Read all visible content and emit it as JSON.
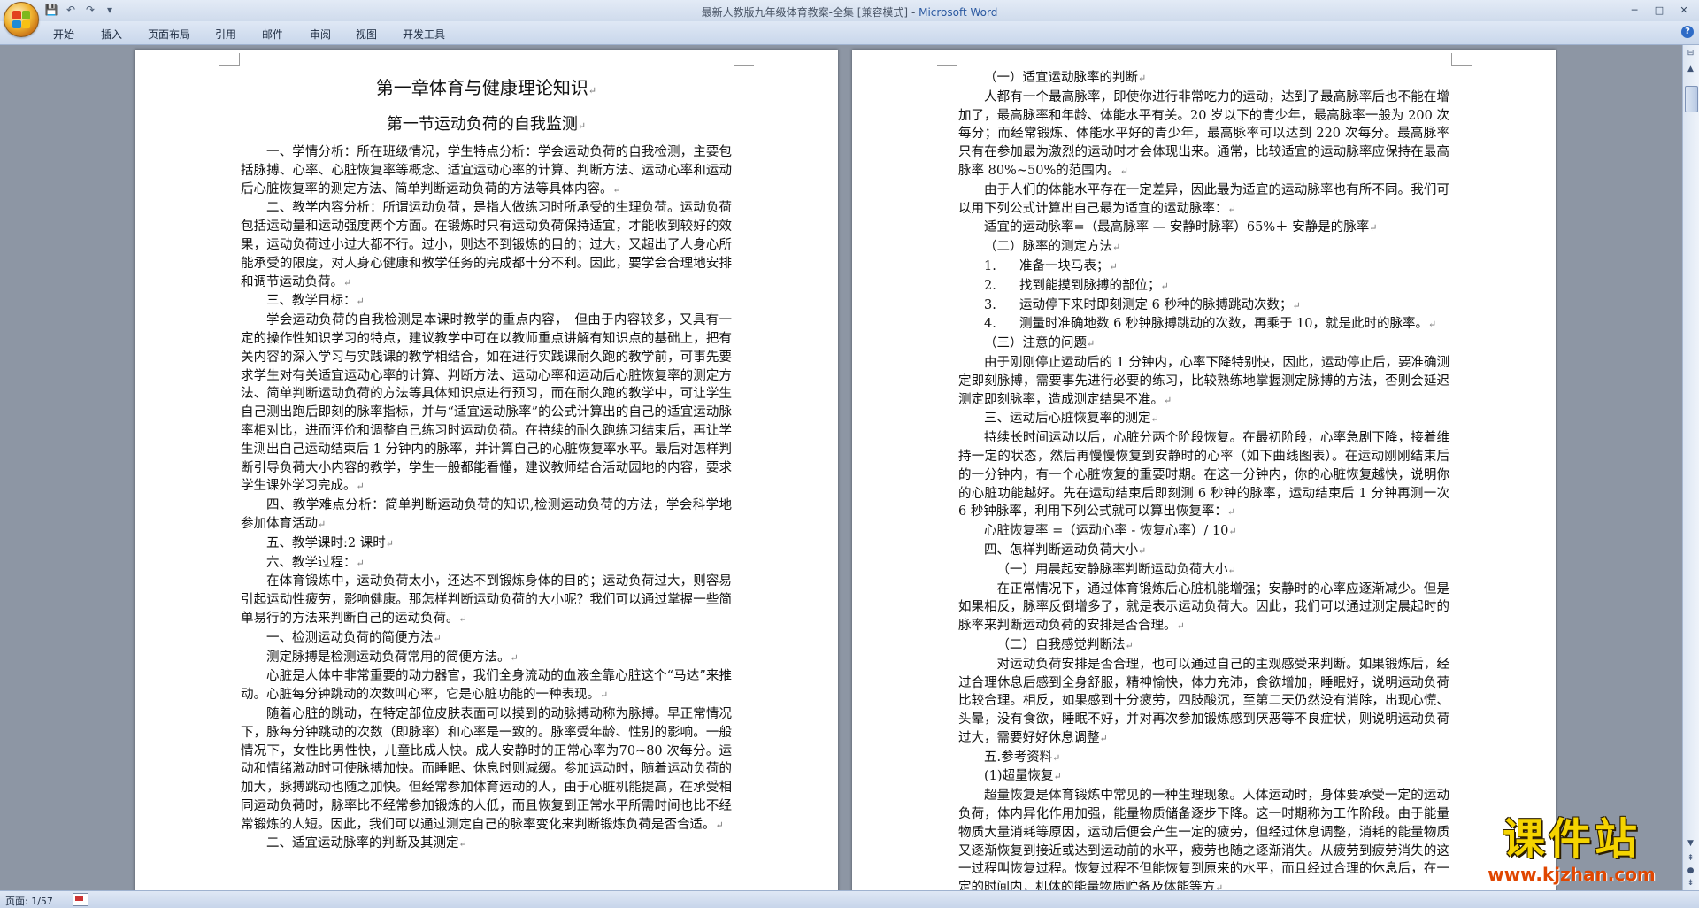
{
  "window": {
    "title": "最新人教版九年级体育教案-全集 [兼容模式]",
    "title_sep": " - ",
    "app_name": "Microsoft Word"
  },
  "quick_access": {
    "save": "💾",
    "undo": "↶",
    "redo": "↷",
    "customize": "▾"
  },
  "ribbon": {
    "tabs": [
      "开始",
      "插入",
      "页面布局",
      "引用",
      "邮件",
      "审阅",
      "视图",
      "开发工具"
    ]
  },
  "help_label": "?",
  "status": {
    "page": "页面: 1/57"
  },
  "watermark": {
    "title": "课件站",
    "url": "www.kjzhan.com"
  },
  "page1": {
    "heading1": "第一章体育与健康理论知识",
    "heading2": "第一节运动负荷的自我监测",
    "paragraphs": [
      "一、学情分析：所在班级情况，学生特点分析：学会运动负荷的自我检测，主要包括脉搏、心率、心脏恢复率等概念、适宜运动心率的计算、判断方法、运动心率和运动后心脏恢复率的测定方法、简单判断运动负荷的方法等具体内容。",
      "二、教学内容分析：所谓运动负荷，是指人做练习时所承受的生理负荷。运动负荷包括运动量和运动强度两个方面。在锻炼时只有运动负荷保持适宜，才能收到较好的效果，运动负荷过小过大都不行。过小，则达不到锻炼的目的；过大，又超出了人身心所能承受的限度，对人身心健康和教学任务的完成都十分不利。因此，要学会合理地安排和调节运动负荷。",
      "三、教学目标：",
      "学会运动负荷的自我检测是本课时教学的重点内容，　但由于内容较多，又具有一定的操作性知识学习的特点，建议教学中可在以教师重点讲解有知识点的基础上，把有关内容的深入学习与实践课的教学相结合，如在进行实践课耐久跑的教学前，可事先要求学生对有关适宜运动心率的计算、判断方法、运动心率和运动后心脏恢复率的测定方法、简单判断运动负荷的方法等具体知识点进行预习，而在耐久跑的教学中，可让学生自己测出跑后即刻的脉率指标，并与“适宜运动脉率”的公式计算出的自己的适宜运动脉率相对比，进而评价和调整自己练习时运动负荷。在持续的耐久跑练习结束后，再让学生测出自己运动结束后 1 分钟内的脉率，并计算自己的心脏恢复率水平。最后对怎样判断引导负荷大小内容的教学，学生一般都能看懂，建议教师结合活动园地的内容，要求学生课外学习完成。",
      "四、教学难点分析：简单判断运动负荷的知识,检测运动负荷的方法，学会科学地参加体育活动",
      "五、教学课时:2 课时",
      "六、教学过程：",
      "在体育锻炼中，运动负荷太小，还达不到锻炼身体的目的；运动负荷过大，则容易引起运动性疲劳，影响健康。那怎样判断运动负荷的大小呢？我们可以通过掌握一些简单易行的方法来判断自己的运动负荷。",
      "一、检测运动负荷的简便方法",
      "测定脉搏是检测运动负荷常用的简便方法。",
      "心脏是人体中非常重要的动力器官，我们全身流动的血液全靠心脏这个“马达”来推动。心脏每分钟跳动的次数叫心率，它是心脏功能的一种表现。",
      "随着心脏的跳动，在特定部位皮肤表面可以摸到的动脉搏动称为脉搏。早正常情况下，脉每分钟跳动的次数（即脉率）和心率是一致的。脉率受年龄、性别的影响。一般情况下，女性比男性快，儿童比成人快。成人安静时的正常心率为70~80 次每分。运动和情绪激动时可使脉搏加快。而睡眠、休息时则减缓。参加运动时，随着运动负荷的加大，脉搏跳动也随之加快。但经常参加体育运动的人，由于心脏机能提高，在承受相同运动负荷时，脉率比不经常参加锻炼的人低，而且恢复到正常水平所需时间也比不经常锻炼的人短。因此，我们可以通过测定自己的脉率变化来判断锻炼负荷是否合适。",
      "二、适宜运动脉率的判断及其测定"
    ]
  },
  "page2": {
    "paragraphs_a": [
      "（一）适宜运动脉率的判断",
      "人都有一个最高脉率，即使你进行非常吃力的运动，达到了最高脉率后也不能在增加了，最高脉率和年龄、体能水平有关。20 岁以下的青少年，最高脉率一般为 200 次每分；而经常锻炼、体能水平好的青少年，最高脉率可以达到 220 次每分。最高脉率只有在参加最为激烈的运动时才会体现出来。通常，比较适宜的运动脉率应保持在最高脉率 80%~50%的范围内。",
      "由于人们的体能水平存在一定差异，因此最为适宜的运动脉率也有所不同。我们可以用下列公式计算出自己最为适宜的运动脉率：",
      "适宜的运动脉率=（最高脉率 — 安静时脉率）65%＋ 安静是的脉率",
      "（二）脉率的测定方法"
    ],
    "steps": [
      {
        "n": "1.",
        "t": "准备一块马表；"
      },
      {
        "n": "2.",
        "t": "找到能摸到脉搏的部位；"
      },
      {
        "n": "3.",
        "t": "运动停下来时即刻测定 6 秒种的脉搏跳动次数；"
      },
      {
        "n": "4.",
        "t": "测量时准确地数 6 秒钟脉搏跳动的次数，再乘于 10，就是此时的脉率。"
      }
    ],
    "paragraphs_b": [
      "（三）注意的问题",
      "由于刚刚停止运动后的 1 分钟内，心率下降特别快，因此，运动停止后，要准确测定即刻脉搏，需要事先进行必要的练习，比较熟练地掌握测定脉搏的方法，否则会延迟测定即刻脉率，造成测定结果不准。",
      "三、运动后心脏恢复率的测定",
      "持续长时间运动以后，心脏分两个阶段恢复。在最初阶段，心率急剧下降，接着维持一定的状态，然后再慢慢恢复到安静时的心率（如下曲线图表）。在运动刚刚结束后的一分钟内，有一个心脏恢复的重要时期。在这一分钟内，你的心脏恢复越快，说明你的心脏功能越好。先在运动结束后即刻测 6 秒钟的脉率，运动结束后 1 分钟再测一次 6 秒钟脉率，利用下列公式就可以算出恢复率：",
      "心脏恢复率 =（运动心率 - 恢复心率）/ 10",
      "四、怎样判断运动负荷大小",
      "（一）用晨起安静脉率判断运动负荷大小",
      "在正常情况下，通过体育锻炼后心脏机能增强；安静时的心率应逐渐减少。但是如果相反，脉率反倒增多了，就是表示运动负荷大。因此，我们可以通过测定晨起时的脉率来判断运动负荷的安排是否合理。",
      "（二）自我感觉判断法",
      "对运动负荷安排是否合理，也可以通过自己的主观感受来判断。如果锻炼后，经过合理休息后感到全身舒服，精神愉快，体力充沛，食欲增加，睡眠好，说明运动负荷比较合理。相反，如果感到十分疲劳，四肢酸沉，至第二天仍然没有消除，出现心慌、头晕，没有食欲，睡眠不好，并对再次参加锻炼感到厌恶等不良症状，则说明运动负荷过大，需要好好休息调整",
      "五.参考资料",
      "(1)超量恢复",
      "超量恢复是体育锻炼中常见的一种生理现象。人体运动时，身体要承受一定的运动负荷，体内异化作用加强，能量物质储备逐步下降。这一时期称为工作阶段。由于能量物质大量消耗等原因，运动后便会产生一定的疲劳，但经过休息调整，消耗的能量物质又逐渐恢复到接近或达到运动前的水平，疲劳也随之逐渐消失。从疲劳到疲劳消失的这一过程叫恢复过程。恢复过程不但能恢复到原来的水平，而且经过合理的休息后，在一定的时间内，机体的能量物质贮备及体能等方"
    ]
  }
}
